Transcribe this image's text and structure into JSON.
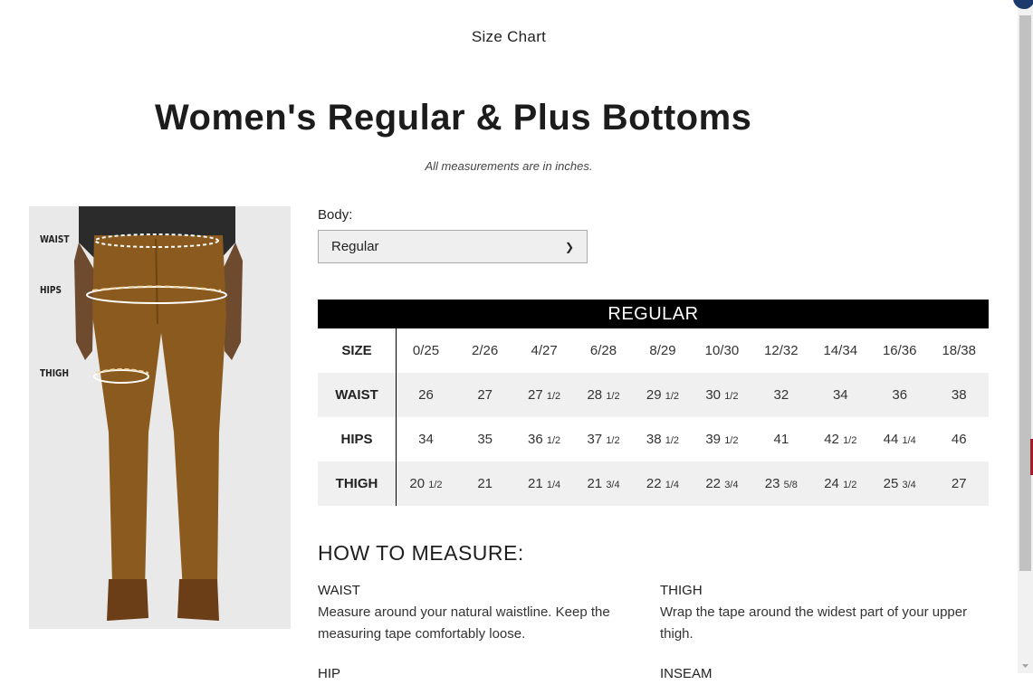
{
  "modal": {
    "title": "Size Chart"
  },
  "page": {
    "heading": "Women's Regular & Plus Bottoms",
    "note": "All measurements are in inches."
  },
  "figure": {
    "labels": {
      "waist": "WAIST",
      "hips": "HIPS",
      "thigh": "THIGH"
    },
    "colors": {
      "pants": "#8a5a1e",
      "top": "#2b2b2b",
      "background": "#e9e9e9"
    }
  },
  "body_select": {
    "label": "Body:",
    "value": "Regular"
  },
  "table": {
    "title": "REGULAR",
    "rows": [
      {
        "label": "SIZE",
        "cells": [
          [
            "0/25",
            ""
          ],
          [
            "2/26",
            ""
          ],
          [
            "4/27",
            ""
          ],
          [
            "6/28",
            ""
          ],
          [
            "8/29",
            ""
          ],
          [
            "10/30",
            ""
          ],
          [
            "12/32",
            ""
          ],
          [
            "14/34",
            ""
          ],
          [
            "16/36",
            ""
          ],
          [
            "18/38",
            ""
          ]
        ]
      },
      {
        "label": "WAIST",
        "cells": [
          [
            "26",
            ""
          ],
          [
            "27",
            ""
          ],
          [
            "27",
            "1/2"
          ],
          [
            "28",
            "1/2"
          ],
          [
            "29",
            "1/2"
          ],
          [
            "30",
            "1/2"
          ],
          [
            "32",
            ""
          ],
          [
            "34",
            ""
          ],
          [
            "36",
            ""
          ],
          [
            "38",
            ""
          ]
        ]
      },
      {
        "label": "HIPS",
        "cells": [
          [
            "34",
            ""
          ],
          [
            "35",
            ""
          ],
          [
            "36",
            "1/2"
          ],
          [
            "37",
            "1/2"
          ],
          [
            "38",
            "1/2"
          ],
          [
            "39",
            "1/2"
          ],
          [
            "41",
            ""
          ],
          [
            "42",
            "1/2"
          ],
          [
            "44",
            "1/4"
          ],
          [
            "46",
            ""
          ]
        ]
      },
      {
        "label": "THIGH",
        "cells": [
          [
            "20",
            "1/2"
          ],
          [
            "21",
            ""
          ],
          [
            "21",
            "1/4"
          ],
          [
            "21",
            "3/4"
          ],
          [
            "22",
            "1/4"
          ],
          [
            "22",
            "3/4"
          ],
          [
            "23",
            "5/8"
          ],
          [
            "24",
            "1/2"
          ],
          [
            "25",
            "3/4"
          ],
          [
            "27",
            ""
          ]
        ]
      }
    ]
  },
  "how_to_measure": {
    "title": "HOW TO MEASURE:",
    "items": [
      {
        "head": "WAIST",
        "text": "Measure around your natural waistline. Keep the measuring tape comfortably loose."
      },
      {
        "head": "THIGH",
        "text": "Wrap the tape around the widest part of your upper thigh."
      },
      {
        "head": "HIP",
        "text": ""
      },
      {
        "head": "INSEAM",
        "text": ""
      }
    ]
  }
}
